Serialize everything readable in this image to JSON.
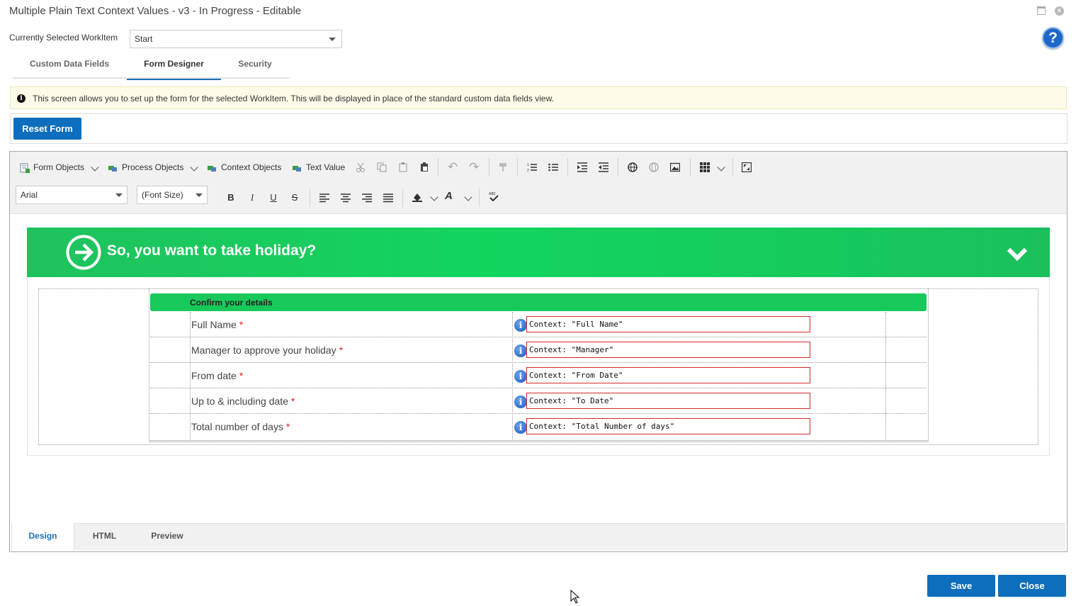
{
  "window": {
    "title": "Multiple Plain Text Context Values - v3 - In Progress - Editable",
    "help_symbol": "?",
    "close_symbol": "×"
  },
  "workitem": {
    "label": "Currently Selected WorkItem",
    "value": "Start"
  },
  "tabs": [
    {
      "label": "Custom Data Fields"
    },
    {
      "label": "Form Designer",
      "active": true
    },
    {
      "label": "Security"
    }
  ],
  "info_bar": {
    "icon": "info-icon",
    "text": "This screen allows you to set up the form for the selected WorkItem. This will be displayed in place of the standard custom data fields view."
  },
  "reset_button": "Reset Form",
  "toolbar": {
    "form_objects": "Form Objects",
    "process_objects": "Process Objects",
    "context_objects": "Context Objects",
    "text_value": "Text Value",
    "font_family": "Arial",
    "font_size": "(Font Size)",
    "bold": "B",
    "italic": "I",
    "underline": "U",
    "strike": "S"
  },
  "form": {
    "header_title": "So, you want to take holiday?",
    "section_title": "Confirm your details",
    "required_marker": "*",
    "info_symbol": "i",
    "rows": [
      {
        "label": "Full Name",
        "context": "Context: \"Full Name\""
      },
      {
        "label": "Manager to approve your holiday",
        "context": "Context: \"Manager\""
      },
      {
        "label": "From date",
        "context": "Context: \"From Date\""
      },
      {
        "label": "Up to & including date",
        "context": "Context: \"To Date\""
      },
      {
        "label": "Total number of days",
        "context": "Context: \"Total Number of days\""
      }
    ]
  },
  "editor_tabs": [
    {
      "label": "Design",
      "active": true
    },
    {
      "label": "HTML"
    },
    {
      "label": "Preview"
    }
  ],
  "footer": {
    "save": "Save",
    "close": "Close"
  },
  "colors": {
    "accent_blue": "#0d6ebd",
    "header_green": "#12d55e",
    "required_red": "#e01d1d"
  }
}
